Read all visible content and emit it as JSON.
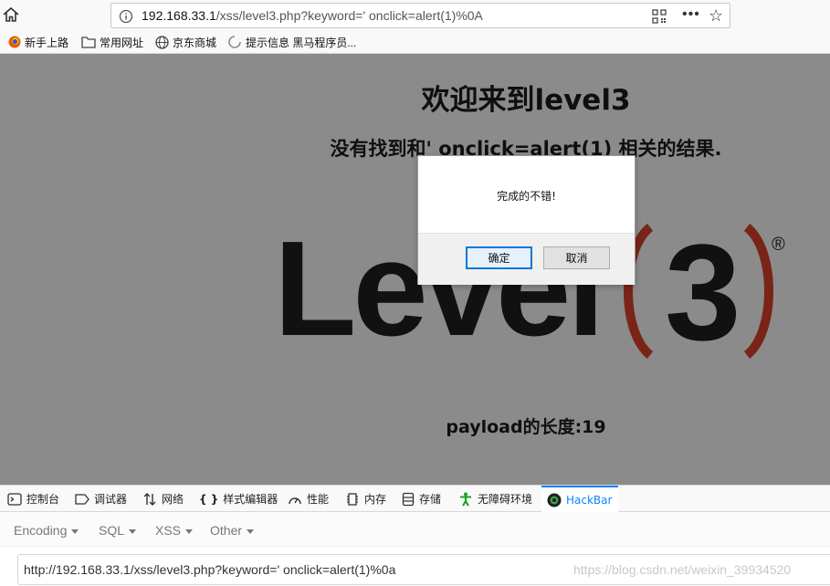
{
  "browser": {
    "url_host": "192.168.33.1",
    "url_path": "/xss/level3.php?keyword=' onclick=alert(1)%0A",
    "bookmarks": [
      {
        "label": "新手上路",
        "icon": "firefox-icon"
      },
      {
        "label": "常用网址",
        "icon": "folder-icon"
      },
      {
        "label": "京东商城",
        "icon": "globe-icon"
      },
      {
        "label": "提示信息 黑马程序员...",
        "icon": "loading-icon"
      }
    ]
  },
  "page": {
    "title": "欢迎来到level3",
    "result": "没有找到和' onclick=alert(1) 相关的结果.",
    "logo_text": "Level",
    "logo_number": "3",
    "logo_registered": "®",
    "payload": "payload的长度:19",
    "colors": {
      "overlay_bg": "#8b8b8b",
      "logo_dark": "#111111",
      "logo_red": "#7a2418"
    }
  },
  "dialog": {
    "message": "完成的不错!",
    "ok_label": "确定",
    "cancel_label": "取消"
  },
  "devtools": {
    "tabs": [
      {
        "label": "控制台",
        "icon": "console-icon"
      },
      {
        "label": "调试器",
        "icon": "debugger-icon"
      },
      {
        "label": "网络",
        "icon": "network-icon"
      },
      {
        "label": "样式编辑器",
        "icon": "style-editor-icon"
      },
      {
        "label": "性能",
        "icon": "performance-icon"
      },
      {
        "label": "内存",
        "icon": "memory-icon"
      },
      {
        "label": "存储",
        "icon": "storage-icon"
      },
      {
        "label": "无障碍环境",
        "icon": "accessibility-icon"
      },
      {
        "label": "HackBar",
        "icon": "hackbar-icon",
        "active": true
      }
    ],
    "accent": "#0a84ff"
  },
  "hackbar": {
    "menus": [
      "Encoding",
      "SQL",
      "XSS",
      "Other"
    ],
    "url_value": "http://192.168.33.1/xss/level3.php?keyword=' onclick=alert(1)%0a"
  },
  "watermark": "https://blog.csdn.net/weixin_39934520"
}
